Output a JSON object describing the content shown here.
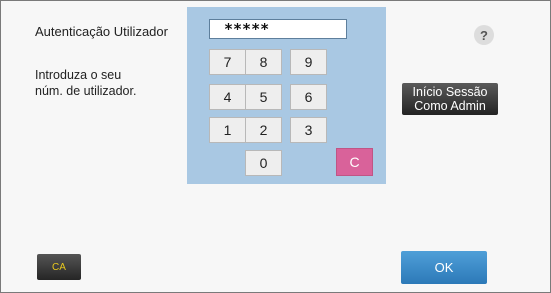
{
  "title": "Autenticação Utilizador",
  "instruction": "Introduza o seu\nnúm. de utilizador.",
  "password_display": "*****",
  "keypad": {
    "keys": [
      "7",
      "8",
      "9",
      "4",
      "5",
      "6",
      "1",
      "2",
      "3",
      "0"
    ],
    "clear_label": "C"
  },
  "help_label": "?",
  "admin_button": {
    "line1": "Início Sessão",
    "line2": "Como Admin"
  },
  "ca_label": "CA",
  "ok_label": "OK",
  "colors": {
    "keypad_bg": "#a9c8e3",
    "clear_key": "#d9629a",
    "ok_button": "#3a8ccb",
    "ca_text": "#e8c81e"
  }
}
